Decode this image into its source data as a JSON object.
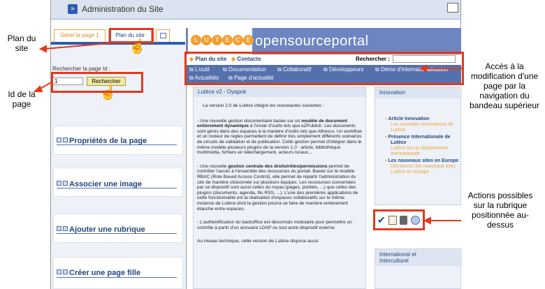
{
  "admin": {
    "title": "Administration du Site"
  },
  "tabs": [
    {
      "label": "Gérer la page 1"
    },
    {
      "label": "Plan du site"
    }
  ],
  "left": {
    "search_label": "Rechercher la page Id :",
    "id_value": "1",
    "search_button": "Rechercher",
    "sections": [
      {
        "label": "Propriétés de la page"
      },
      {
        "label": "Associer une image"
      },
      {
        "label": "Ajouter une rubrique"
      },
      {
        "label": "Créer une page fille"
      }
    ]
  },
  "logo": {
    "letters": [
      "L",
      "U",
      "T",
      "E",
      "C",
      "E"
    ],
    "brand": "opensourceportal"
  },
  "nav": {
    "plan": "Plan du site",
    "contacts": "Contacts",
    "search_label": "Rechercher :",
    "menu": [
      "L'outil",
      "Documentation",
      "Collaboratif",
      "Développeurs",
      "Démo d'internationalisation",
      "Actualités",
      "Page d'actualité"
    ]
  },
  "article": {
    "title": "Lutèce v2 - Oyapok",
    "intro": "La version 2.0 de Lutèce intègre les nouveautés suivantes :",
    "p1a": "- Une nouvelle gestion documentaire basée sur un ",
    "p1b": "modèle de document entièrement dynamique",
    "p1c": " à l'instar d'outils tels que eZPublish. Les documents sont gérés dans des espaces à la manière d'outils tels que Alfresco. Un workflow et un moteur de règles permettent de définir très simplement différents scénarios de circuits de validation et de publication. Cette gestion permet d'intégrer dans le même modèle plusieurs plugins de la version 1.0 : article, bibliothèque multimédia, fichiers en téléchargement, acteurs locaux...",
    "p2a": "- Une nouvelle ",
    "p2b": "gestion centrale des droits/rôles/permissions",
    "p2c": " permet de contrôler l'accès à l'ensemble des ressources du portail. Basée sur le modèle RBAC (Role Based Access Control), elle permet de répartir l'administration du site de manière cloisonnée sur plusieurs équipes. Les ressources concernées par ce dispositif sont aussi celles du noyau (pages, portlets, ...) que celles des plugins (documents, agenda, fils RSS, ...). L'une des premières applications de cette fonctionnalité est la réalisation d'espaces collaboratifs sur le même instance de Lutèce dont la gestion pourra se faire de manière entièrement étanche entre espaces.",
    "p3": "- L'authentification du backoffice est désormais modulaire pour permettre un contrôle à partir d'un annuaire LDAP ou tout autre dispositif externe.",
    "p4": "Au niveau technique, cette version de Lutèce dispose aussi"
  },
  "innovation": {
    "title": "Innovation",
    "items": [
      {
        "title": "Article Innovation",
        "desc": "Les nouvelles innovations de Lutèce"
      },
      {
        "title": "Présence Internationale de Lutèce",
        "desc": "Lutèce est un déploiement internationale"
      },
      {
        "title": "Les nouveaux sites en Europe",
        "desc": "Découvrez les nouveaux sites Lutèce en Europe"
      }
    ]
  },
  "international": {
    "title": "International et Interculturel"
  },
  "callouts": {
    "plan": "Plan du site",
    "id": "Id de la page",
    "acces": "Accès à la modification d'une page par la navigation du bandeau supérieur",
    "actions": "Actions possibles sur la rubrique positionnée au-dessus"
  },
  "colors": {
    "red": "#e33a1e",
    "navy": "#24477f",
    "nav_bg": "#5571ad"
  }
}
